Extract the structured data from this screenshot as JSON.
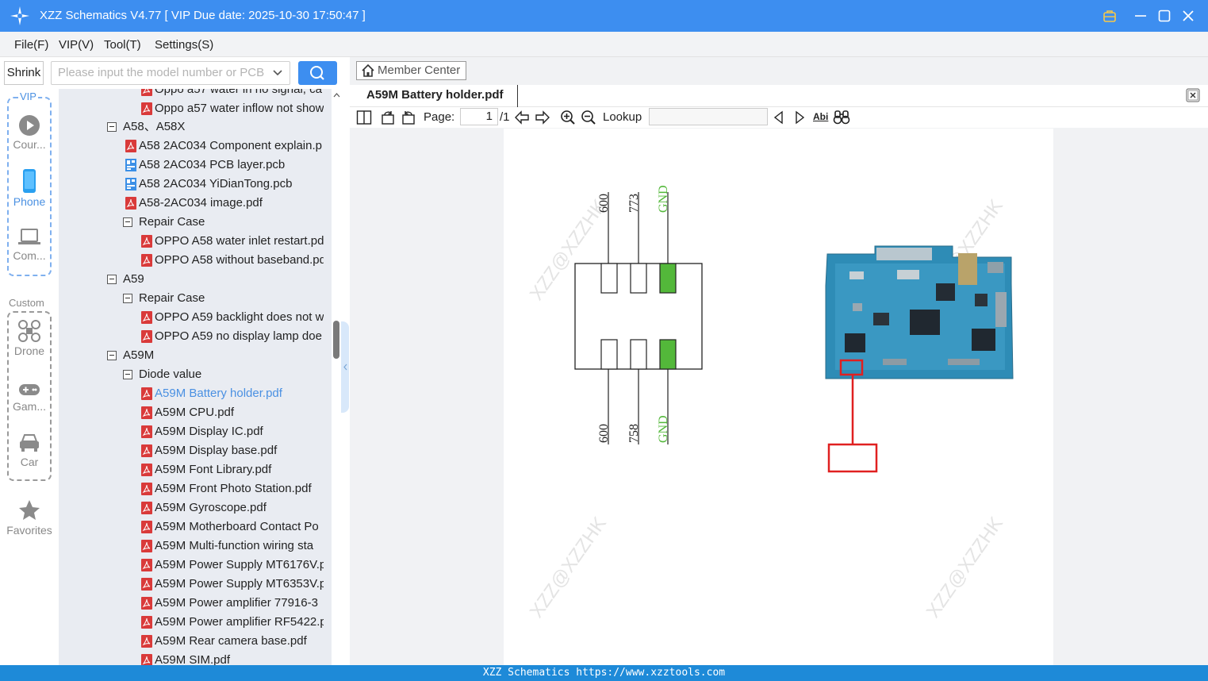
{
  "window": {
    "title": "XZZ Schematics V4.77 [ VIP Due date: 2025-10-30 17:50:47 ]"
  },
  "menu": [
    "File(F)",
    "VIP(V)",
    "Tool(T)",
    "Settings(S)"
  ],
  "search": {
    "shrink_label": "Shrink",
    "placeholder": "Please input the model number or PCB"
  },
  "leftnav": {
    "vip_label": "VIP",
    "custom_label": "Custom",
    "items": [
      "Cour...",
      "Phone",
      "Com...",
      "Drone",
      "Gam...",
      "Car",
      "Favorites"
    ],
    "active": "Phone"
  },
  "tree": [
    {
      "label": "Oppo a57 water in no signal, ca",
      "type": "pdf",
      "level": 2
    },
    {
      "label": "Oppo a57 water inflow not show",
      "type": "pdf",
      "level": 2
    },
    {
      "label": "A58、A58X",
      "type": "folder",
      "level": 0
    },
    {
      "label": "A58 2AC034 Component explain.p",
      "type": "pdf",
      "level": 1
    },
    {
      "label": "A58 2AC034 PCB layer.pcb",
      "type": "pcb",
      "level": 1
    },
    {
      "label": "A58 2AC034 YiDianTong.pcb",
      "type": "pcb",
      "level": 1
    },
    {
      "label": "A58-2AC034 image.pdf",
      "type": "pdf",
      "level": 1
    },
    {
      "label": "Repair Case",
      "type": "folder",
      "level": 1
    },
    {
      "label": "OPPO A58 water inlet restart.pd",
      "type": "pdf",
      "level": 2
    },
    {
      "label": "OPPO A58 without baseband.pd",
      "type": "pdf",
      "level": 2
    },
    {
      "label": "A59",
      "type": "folder",
      "level": 0
    },
    {
      "label": "Repair Case",
      "type": "folder",
      "level": 1
    },
    {
      "label": "OPPO A59 backlight does not w",
      "type": "pdf",
      "level": 2
    },
    {
      "label": "OPPO A59 no display lamp doe",
      "type": "pdf",
      "level": 2
    },
    {
      "label": "A59M",
      "type": "folder",
      "level": 0
    },
    {
      "label": "Diode value",
      "type": "folder",
      "level": 1
    },
    {
      "label": "A59M Battery holder.pdf",
      "type": "pdf",
      "level": 2,
      "selected": true
    },
    {
      "label": "A59M CPU.pdf",
      "type": "pdf",
      "level": 2
    },
    {
      "label": "A59M Display IC.pdf",
      "type": "pdf",
      "level": 2
    },
    {
      "label": "A59M Display base.pdf",
      "type": "pdf",
      "level": 2
    },
    {
      "label": "A59M Font Library.pdf",
      "type": "pdf",
      "level": 2
    },
    {
      "label": "A59M Front Photo Station.pdf",
      "type": "pdf",
      "level": 2
    },
    {
      "label": "A59M Gyroscope.pdf",
      "type": "pdf",
      "level": 2
    },
    {
      "label": "A59M Motherboard Contact Po",
      "type": "pdf",
      "level": 2
    },
    {
      "label": "A59M Multi-function wiring sta",
      "type": "pdf",
      "level": 2
    },
    {
      "label": "A59M Power Supply MT6176V.p",
      "type": "pdf",
      "level": 2
    },
    {
      "label": "A59M Power Supply MT6353V.p",
      "type": "pdf",
      "level": 2
    },
    {
      "label": "A59M Power amplifier 77916-3",
      "type": "pdf",
      "level": 2
    },
    {
      "label": "A59M Power amplifier RF5422.p",
      "type": "pdf",
      "level": 2
    },
    {
      "label": "A59M Rear camera base.pdf",
      "type": "pdf",
      "level": 2
    },
    {
      "label": "A59M SIM.pdf",
      "type": "pdf",
      "level": 2
    }
  ],
  "viewer": {
    "member_center": "Member Center",
    "tab_title": "A59M Battery holder.pdf",
    "page_label": "Page:",
    "page_current": "1",
    "page_total": "/1",
    "lookup_label": "Lookup",
    "abi_label": "Abi"
  },
  "diagram": {
    "top_labels": [
      "600",
      "773",
      "GND"
    ],
    "bottom_labels": [
      "600",
      "758",
      "GND"
    ],
    "pad_highlight_color": "#53b83a",
    "marker_color": "#e02020",
    "watermark": "XZZ@XZZHK"
  },
  "status": {
    "text": "XZZ Schematics https://www.xzztools.com"
  }
}
